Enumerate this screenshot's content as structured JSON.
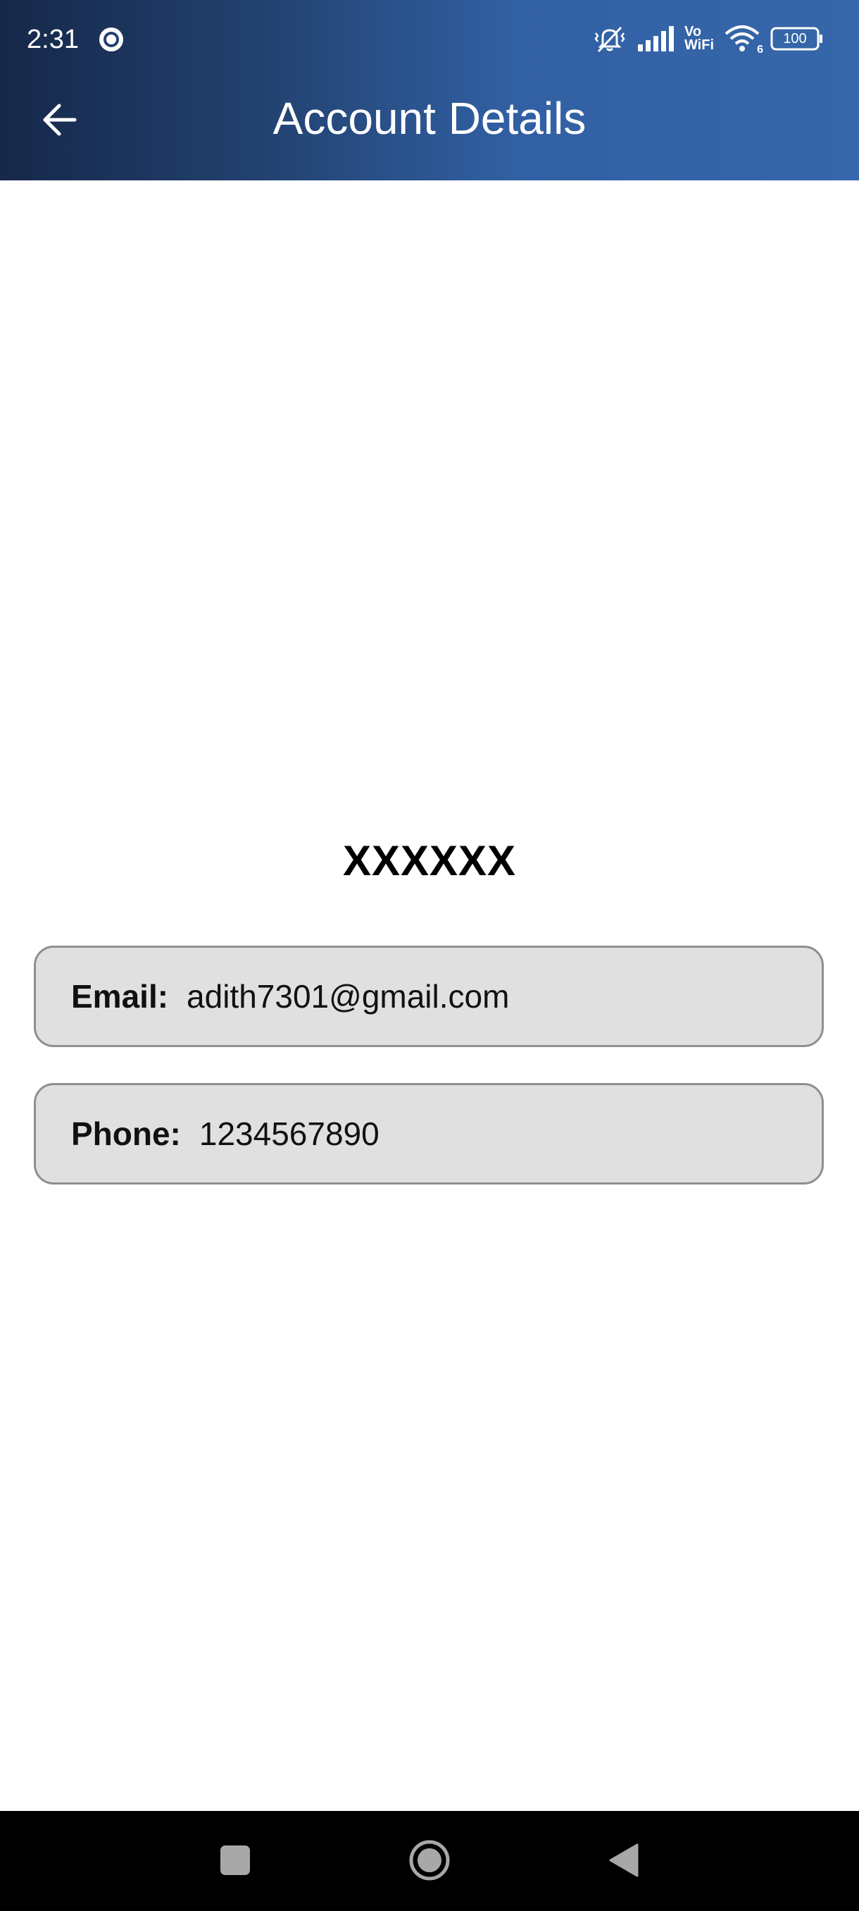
{
  "status_bar": {
    "time": "2:31",
    "network_label_top": "Vo",
    "network_label_bottom": "WiFi",
    "wifi_badge": "6",
    "battery": "100"
  },
  "header": {
    "title": "Account Details",
    "back_icon": "arrow-left-icon"
  },
  "account": {
    "name": "XXXXXX",
    "email_label": "Email:",
    "email_value": "adith7301@gmail.com",
    "phone_label": "Phone:",
    "phone_value": "1234567890"
  },
  "nav_bar": {
    "icons": [
      "recents-square-icon",
      "home-circle-icon",
      "back-triangle-icon"
    ]
  },
  "colors": {
    "header_gradient_start": "#16284a",
    "header_gradient_end": "#3767ab",
    "field_background": "#e0e0e0",
    "field_border": "#8f8f8f",
    "nav_bar": "#000000"
  }
}
